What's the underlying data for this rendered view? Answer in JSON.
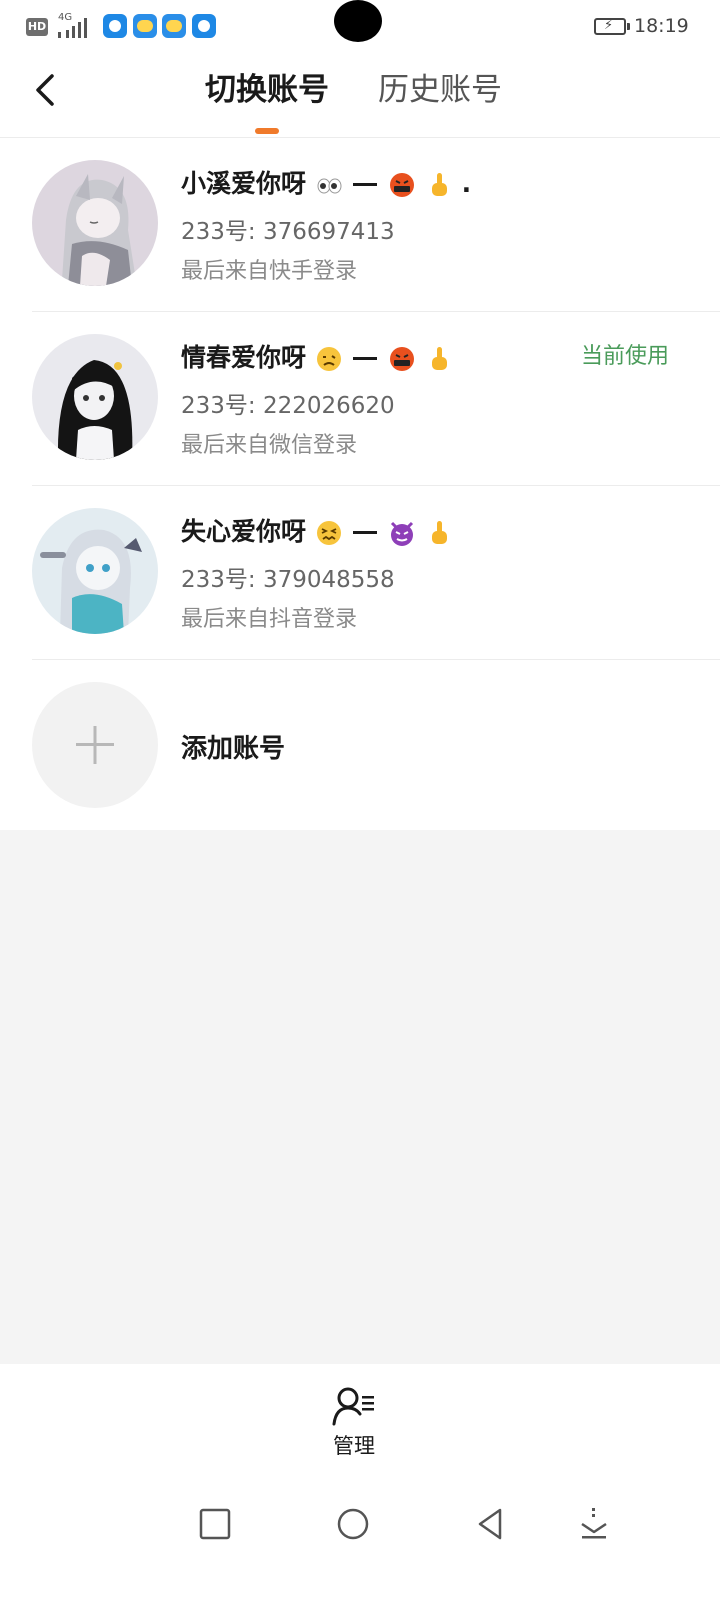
{
  "status_bar": {
    "hd_label": "HD",
    "network": "4G",
    "time": "18:19"
  },
  "header": {
    "tabs": [
      {
        "label": "切换账号",
        "active": true
      },
      {
        "label": "历史账号",
        "active": false
      }
    ],
    "accent_color": "#f07a2b"
  },
  "accounts": [
    {
      "name": "小溪爱你呀",
      "emojis": [
        "eyes",
        "dash",
        "cursing-face",
        "middle-finger",
        "dot"
      ],
      "id": "233号: 376697413",
      "source": "最后来自快手登录",
      "current": ""
    },
    {
      "name": "情春爱你呀",
      "emojis": [
        "woozy-face",
        "dash",
        "cursing-face",
        "middle-finger"
      ],
      "id": "233号: 222026620",
      "source": "最后来自微信登录",
      "current": "当前使用"
    },
    {
      "name": "失心爱你呀",
      "emojis": [
        "confounded-face",
        "dash",
        "devil-face",
        "middle-finger"
      ],
      "id": "233号: 379048558",
      "source": "最后来自抖音登录",
      "current": ""
    }
  ],
  "add_account": {
    "label": "添加账号"
  },
  "bottom": {
    "manage_label": "管理"
  },
  "colors": {
    "current_badge": "#4a9b5a",
    "page_bg": "#f4f4f4"
  }
}
